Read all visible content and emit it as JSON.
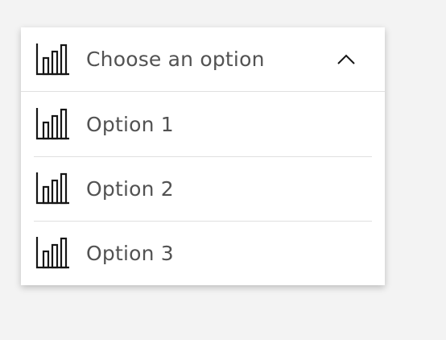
{
  "dropdown": {
    "placeholder": "Choose an option",
    "expanded": true,
    "icon": "bar-chart-icon",
    "chevron_icon": "chevron-up-icon",
    "options": [
      {
        "label": "Option 1",
        "icon": "bar-chart-icon"
      },
      {
        "label": "Option 2",
        "icon": "bar-chart-icon"
      },
      {
        "label": "Option 3",
        "icon": "bar-chart-icon"
      }
    ]
  },
  "colors": {
    "background": "#f3f3f3",
    "surface": "#ffffff",
    "text": "#525252",
    "icon": "#161616",
    "divider": "#e0e0e0"
  }
}
